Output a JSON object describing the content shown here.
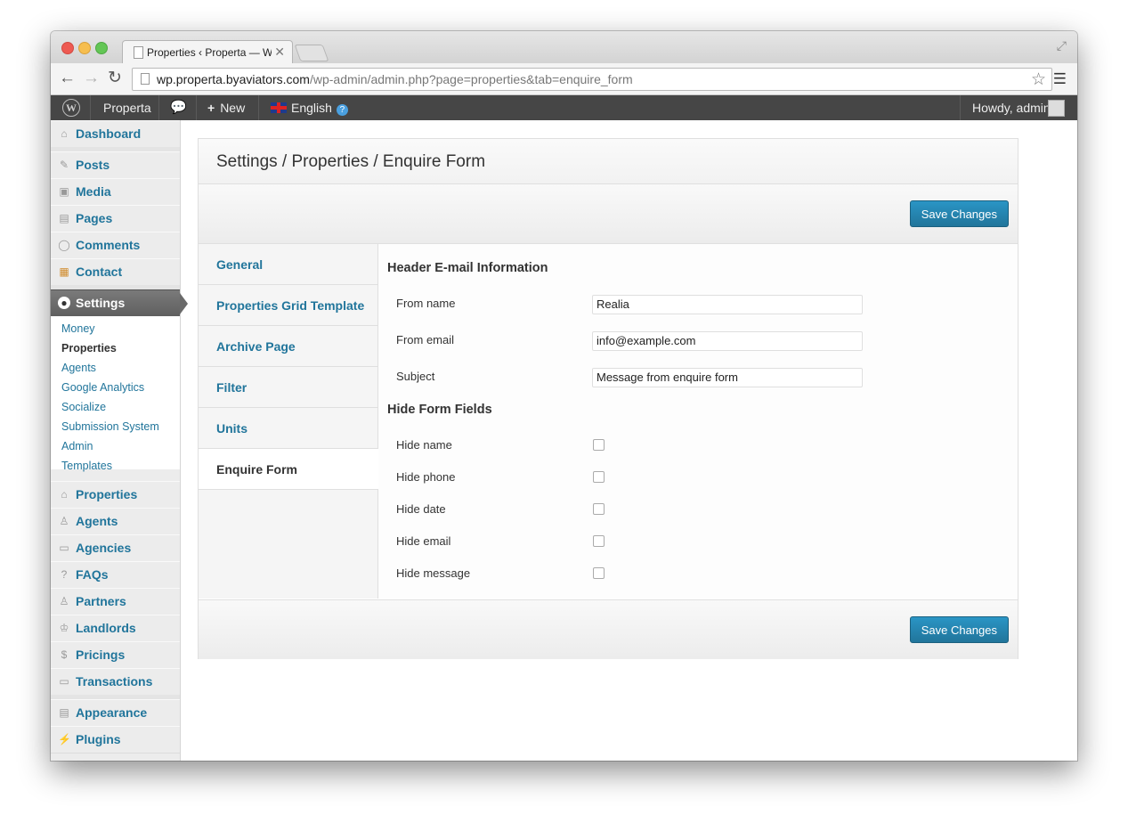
{
  "browser": {
    "tab_title": "Properties ‹ Properta — Wo",
    "tab_close": "✕",
    "url_host": "wp.properta.byaviators.com",
    "url_path": "/wp-admin/admin.php?page=properties&tab=enquire_form"
  },
  "adminbar": {
    "site_name": "Properta",
    "new_label": "New",
    "language": "English",
    "greeting": "Howdy, admin"
  },
  "menu": {
    "top_items": [
      "Dashboard",
      "Posts",
      "Media",
      "Pages",
      "Comments",
      "Contact"
    ],
    "current": "Settings",
    "submenu": [
      "Money",
      "Properties",
      "Agents",
      "Google Analytics",
      "Socialize",
      "Submission System",
      "Admin",
      "Templates"
    ],
    "submenu_active": "Properties",
    "lower_items": [
      "Properties",
      "Agents",
      "Agencies",
      "FAQs",
      "Partners",
      "Landlords",
      "Pricings",
      "Transactions"
    ],
    "bottom_items": [
      "Appearance",
      "Plugins"
    ]
  },
  "page": {
    "title": "Settings / Properties / Enquire Form",
    "save_label": "Save Changes",
    "tabs": [
      "General",
      "Properties Grid Template",
      "Archive Page",
      "Filter",
      "Units",
      "Enquire Form"
    ],
    "active_tab": "Enquire Form"
  },
  "form": {
    "section1_title": "Header E-mail Information",
    "from_name_label": "From name",
    "from_name_value": "Realia",
    "from_email_label": "From email",
    "from_email_value": "info@example.com",
    "subject_label": "Subject",
    "subject_value": "Message from enquire form",
    "section2_title": "Hide Form Fields",
    "hide_fields": [
      {
        "label": "Hide name",
        "checked": false
      },
      {
        "label": "Hide phone",
        "checked": false
      },
      {
        "label": "Hide date",
        "checked": false
      },
      {
        "label": "Hide email",
        "checked": false
      },
      {
        "label": "Hide message",
        "checked": false
      }
    ]
  },
  "colors": {
    "link": "#21759b",
    "button": "#21759b",
    "adminbar": "#464646"
  }
}
